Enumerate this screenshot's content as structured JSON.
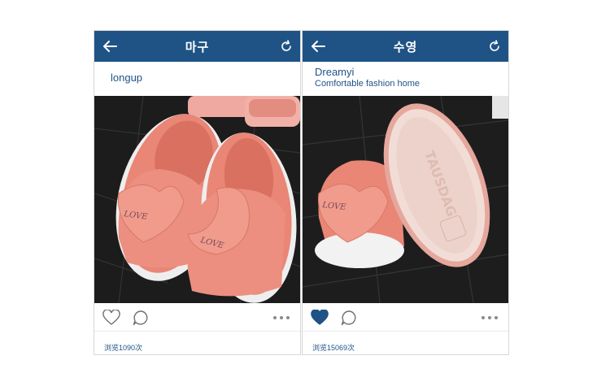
{
  "posts": [
    {
      "header_title": "마구",
      "author": "longup",
      "bio": "",
      "liked": false,
      "views": "浏览1090次"
    },
    {
      "header_title": "수영",
      "author": "Dreamyi",
      "bio": "Comfortable fashion home",
      "liked": true,
      "views": "浏览15069次"
    }
  ],
  "icons": {
    "back": "back-arrow-icon",
    "refresh": "refresh-icon",
    "like": "heart-icon",
    "comment": "comment-icon",
    "more": "more-dots-icon"
  },
  "colors": {
    "header": "#1f5386",
    "accent": "#1f5386",
    "slipper_pink": "#e98676",
    "floor": "#1c1c1c"
  }
}
